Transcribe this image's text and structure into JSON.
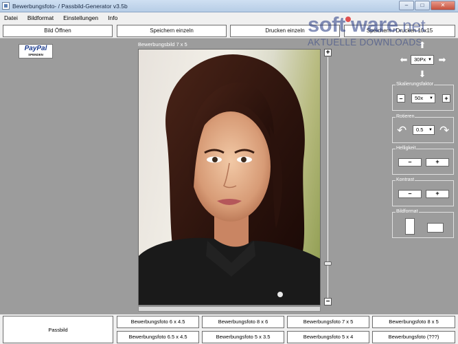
{
  "window": {
    "title": "Bewerbungsfoto- / Passbild-Generator v3.5b",
    "minimize": "–",
    "maximize": "□",
    "close": "✕"
  },
  "menu": [
    "Datei",
    "Bildformat",
    "Einstellungen",
    "Info"
  ],
  "toolbar": {
    "open": "Bild Öffnen",
    "save_single": "Speichern einzeln",
    "print_single": "Drucken einzeln",
    "save_print": "Speichern / Drucken 10x15"
  },
  "watermark": {
    "name_left": "soft",
    "name_right": "ware",
    "name_suffix": ".net",
    "tagline": "AKTUELLE DOWNLOADS"
  },
  "paypal": {
    "brand": "PayPal",
    "caption": "SPENDEN"
  },
  "image": {
    "title": "Bewerbungsbild 7 x 5"
  },
  "controls": {
    "move_step": "30Px",
    "scale": {
      "label": "Skalierungsfaktor",
      "value": "50x",
      "minus": "–",
      "plus": "+"
    },
    "rotate": {
      "label": "Rotieren",
      "value": "0.5"
    },
    "brightness": {
      "label": "Helligkeit",
      "minus": "–",
      "plus": "+"
    },
    "contrast": {
      "label": "Kontrast",
      "minus": "–",
      "plus": "+"
    },
    "format": {
      "label": "Bildformat"
    }
  },
  "bottom": {
    "passbild": "Passbild",
    "row1": [
      "Bewerbungsfoto 6 x 4.5",
      "Bewerbungsfoto 8 x 6",
      "Bewerbungsfoto 7 x 5",
      "Bewerbungsfoto 8 x 5"
    ],
    "row2": [
      "Bewerbungsfoto 6.5 x 4.5",
      "Bewerbungsfoto 5 x 3.5",
      "Bewerbungsfoto 5 x 4",
      "Bewerbungsfoto (???)"
    ]
  }
}
